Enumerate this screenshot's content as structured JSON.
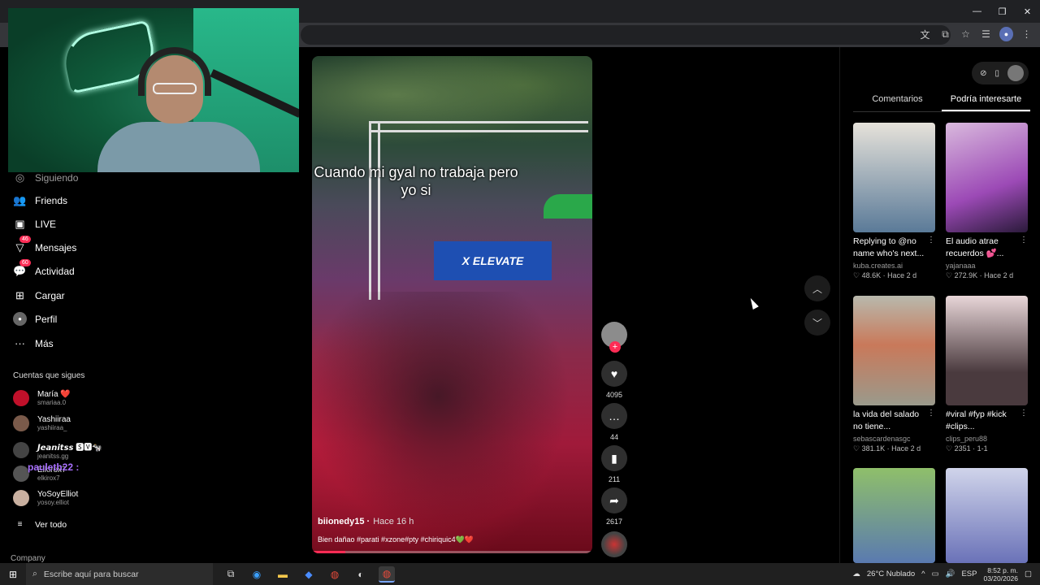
{
  "browser": {
    "toolbar_icons": [
      "translate-icon",
      "cast-icon",
      "star-icon",
      "playlist-icon",
      "profile-icon",
      "menu-icon"
    ],
    "window_controls": [
      "—",
      "❐",
      "✕"
    ]
  },
  "sidebar": {
    "items": [
      {
        "label": "Siguiendo",
        "icon": "following-icon"
      },
      {
        "label": "Friends",
        "icon": "friends-icon"
      },
      {
        "label": "LIVE",
        "icon": "live-icon"
      },
      {
        "label": "Mensajes",
        "icon": "messages-icon",
        "badge": "46"
      },
      {
        "label": "Actividad",
        "icon": "activity-icon",
        "badge": "60"
      },
      {
        "label": "Cargar",
        "icon": "upload-icon"
      },
      {
        "label": "Perfil",
        "icon": "profile-icon"
      },
      {
        "label": "Más",
        "icon": "more-icon"
      }
    ],
    "following_title": "Cuentas que sigues",
    "following": [
      {
        "name": "María ❤️",
        "handle": "smariaa.0"
      },
      {
        "name": "Yashiiraa",
        "handle": "yashiiraa_"
      },
      {
        "name": "𝙅𝙚𝙖𝙣𝙞𝙩𝙨𝙨 🆂🆅🐄",
        "handle": "jeanitss.gg"
      },
      {
        "name": "Elkirox7",
        "handle": "elkirox7"
      },
      {
        "name": "YoSoyElliot",
        "handle": "yosoy.elliot"
      }
    ],
    "see_all": "Ver todo",
    "company": "Company",
    "chat_overlay": "pauleth22 :"
  },
  "video": {
    "caption": "Cuando mi gyal no trabaja pero yo si",
    "banner_text": "X ELEVATE",
    "author": "biionedy15",
    "time": "Hace 16 h",
    "description": "Bien dañao #parati #xzone#pty #chiriquic4💚❤️",
    "progress": 0.12
  },
  "actions": {
    "likes": "4095",
    "comments": "44",
    "saves": "211",
    "shares": "2617"
  },
  "right_panel": {
    "tabs": [
      "Comentarios",
      "Podría interesarte"
    ],
    "active_tab": 1,
    "cards": [
      {
        "title": "Replying to @no name who's next...",
        "user": "kuba.creates.ai",
        "meta": "♡ 48.6K · Hace 2 d",
        "color": "#6f8aa3"
      },
      {
        "title": "El audio atrae recuerdos 💕...",
        "user": "yajanaaa",
        "meta": "♡ 272.9K · Hace 2 d",
        "color": "#8a4fa6"
      },
      {
        "title": "la vida del salado no tiene...",
        "user": "sebascardenasgc",
        "meta": "♡ 381.1K · Hace 2 d",
        "color": "#8c8f7c"
      },
      {
        "title": "#viral #fyp #kick #clips...",
        "user": "clips_peru88",
        "meta": "♡ 2351 · 1-1",
        "color": "#5a4a52"
      },
      {
        "title": "",
        "user": "",
        "meta": "",
        "color": "#6aa05a"
      },
      {
        "title": "",
        "user": "",
        "meta": "",
        "color": "#6a72b8"
      }
    ]
  },
  "taskbar": {
    "search_placeholder": "Escribe aquí para buscar",
    "weather": "26°C  Nublado",
    "lang": "ESP",
    "time": "8:52 p. m.",
    "date": "03/20/2026"
  }
}
